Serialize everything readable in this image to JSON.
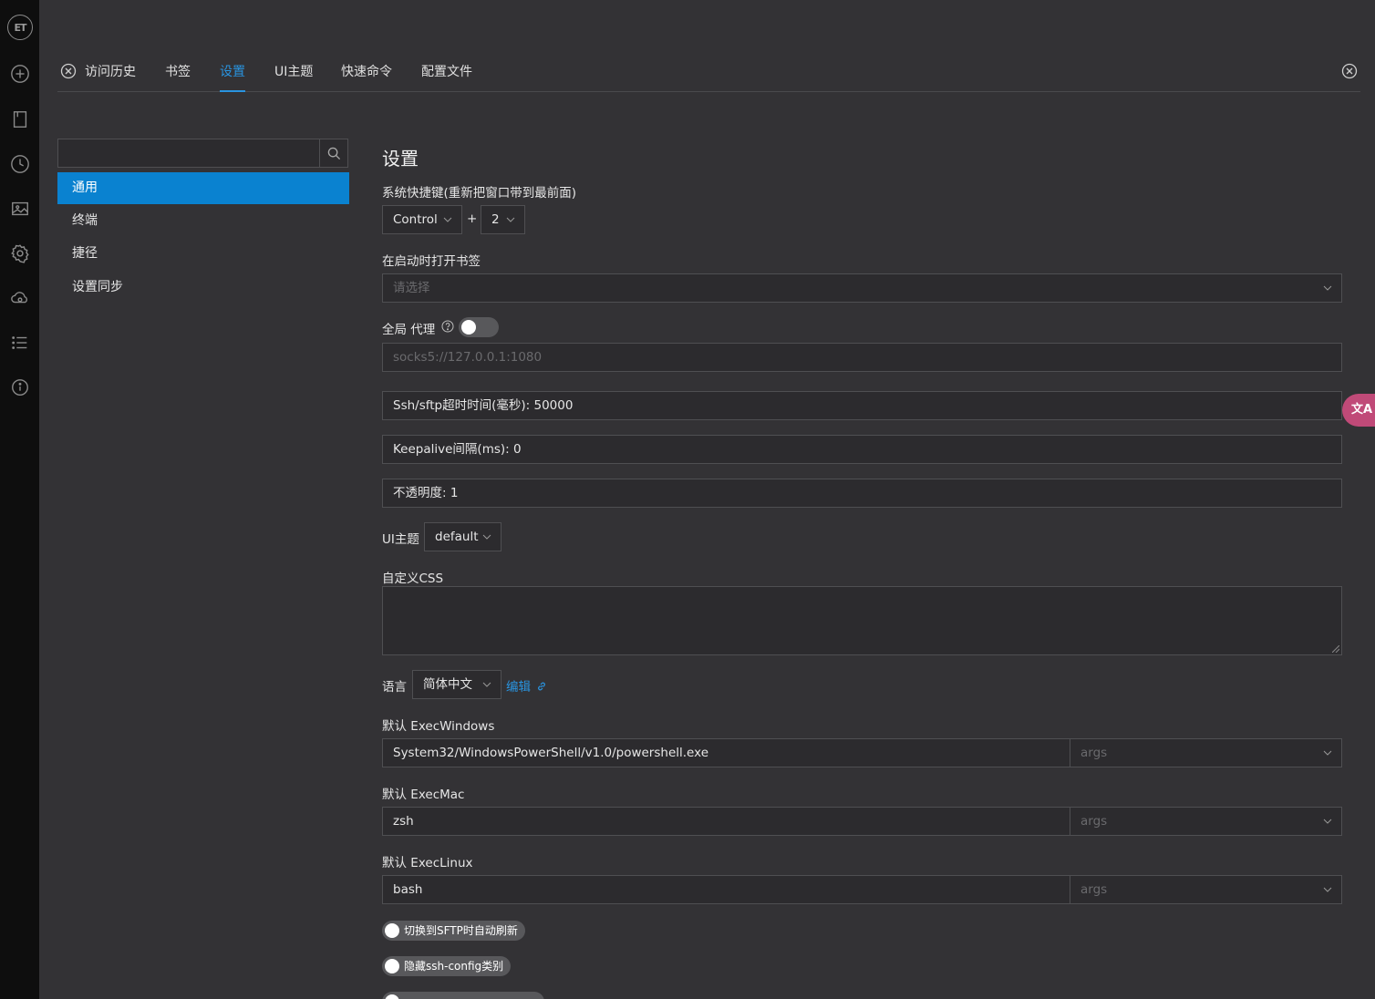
{
  "rail": {
    "logo": "ET",
    "icons": [
      "add-icon",
      "bookmark-icon",
      "history-icon",
      "image-icon",
      "settings-icon",
      "cloud-sync-icon",
      "list-icon",
      "info-icon"
    ]
  },
  "tabs": {
    "items": [
      {
        "label": "访问历史"
      },
      {
        "label": "书签"
      },
      {
        "label": "设置"
      },
      {
        "label": "UI主题"
      },
      {
        "label": "快速命令"
      },
      {
        "label": "配置文件"
      }
    ],
    "active": "设置"
  },
  "sidebar": {
    "search_placeholder": "",
    "items": [
      {
        "label": "通用"
      },
      {
        "label": "终端"
      },
      {
        "label": "捷径"
      },
      {
        "label": "设置同步"
      }
    ]
  },
  "settings": {
    "title": "设置",
    "hotkey_label": "系统快捷键(重新把窗口带到最前面)",
    "hotkey_modifier": "Control",
    "hotkey_plus": "+",
    "hotkey_key": "2",
    "open_bookmarks_label": "在启动时打开书签",
    "open_bookmarks_placeholder": "请选择",
    "proxy_label": "全局 代理",
    "proxy_placeholder": "socks5://127.0.0.1:1080",
    "ssh_timeout": "Ssh/sftp超时时间(毫秒): 50000",
    "keepalive": "Keepalive间隔(ms): 0",
    "opacity": "不透明度: 1",
    "ui_theme_label": "UI主题",
    "ui_theme_value": "default",
    "custom_css_label": "自定义CSS",
    "language_label": "语言",
    "language_value": "简体中文",
    "language_edit": "编辑",
    "exec_windows_label": "默认 ExecWindows",
    "exec_windows_value": "System32/WindowsPowerShell/v1.0/powershell.exe",
    "exec_mac_label": "默认 ExecMac",
    "exec_mac_value": "zsh",
    "exec_linux_label": "默认 ExecLinux",
    "exec_linux_value": "bash",
    "args_placeholder": "args",
    "toggle_sftp_refresh": "切换到SFTP时自动刷新",
    "toggle_hide_ssh_config": "隐藏ssh-config类别"
  },
  "floating": {
    "translate_label": "文A"
  },
  "colors": {
    "accent": "#0a82d0",
    "link": "#2994e0",
    "background": "#333235",
    "rail": "#0e0e0e",
    "translate": "#c04a78"
  }
}
